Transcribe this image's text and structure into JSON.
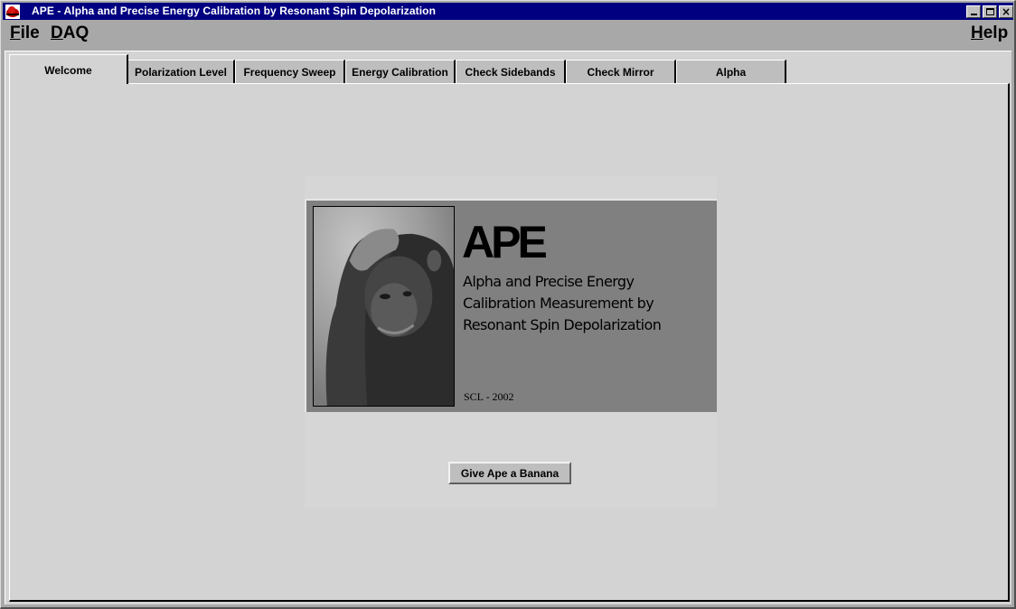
{
  "window": {
    "title": "APE - Alpha and Precise Energy Calibration by Resonant Spin Depolarization",
    "app_icon": "redhat-icon",
    "controls": {
      "minimize": "minimize-icon",
      "maximize": "maximize-icon",
      "close": "close-icon"
    },
    "titlebar_color": "#000080"
  },
  "menubar": {
    "items": [
      {
        "mnemonic": "F",
        "rest": "ile",
        "label": "File"
      },
      {
        "mnemonic": "D",
        "rest": "AQ",
        "label": "DAQ"
      },
      {
        "mnemonic": "H",
        "rest": "elp",
        "label": "Help"
      }
    ]
  },
  "tabs": [
    {
      "label": "Welcome",
      "active": true
    },
    {
      "label": "Polarization Level",
      "active": false
    },
    {
      "label": "Frequency Sweep",
      "active": false
    },
    {
      "label": "Energy Calibration",
      "active": false
    },
    {
      "label": "Check Sidebands",
      "active": false
    },
    {
      "label": "Check Mirror",
      "active": false
    },
    {
      "label": "Alpha",
      "active": false
    }
  ],
  "welcome": {
    "splash": {
      "image": "chimpanzee-photo",
      "title": "APE",
      "subtitle_lines": [
        "Alpha and Precise Energy",
        "Calibration Measurement by",
        "Resonant Spin Depolarization"
      ],
      "credit": "SCL - 2002"
    },
    "button_label": "Give Ape a Banana"
  }
}
